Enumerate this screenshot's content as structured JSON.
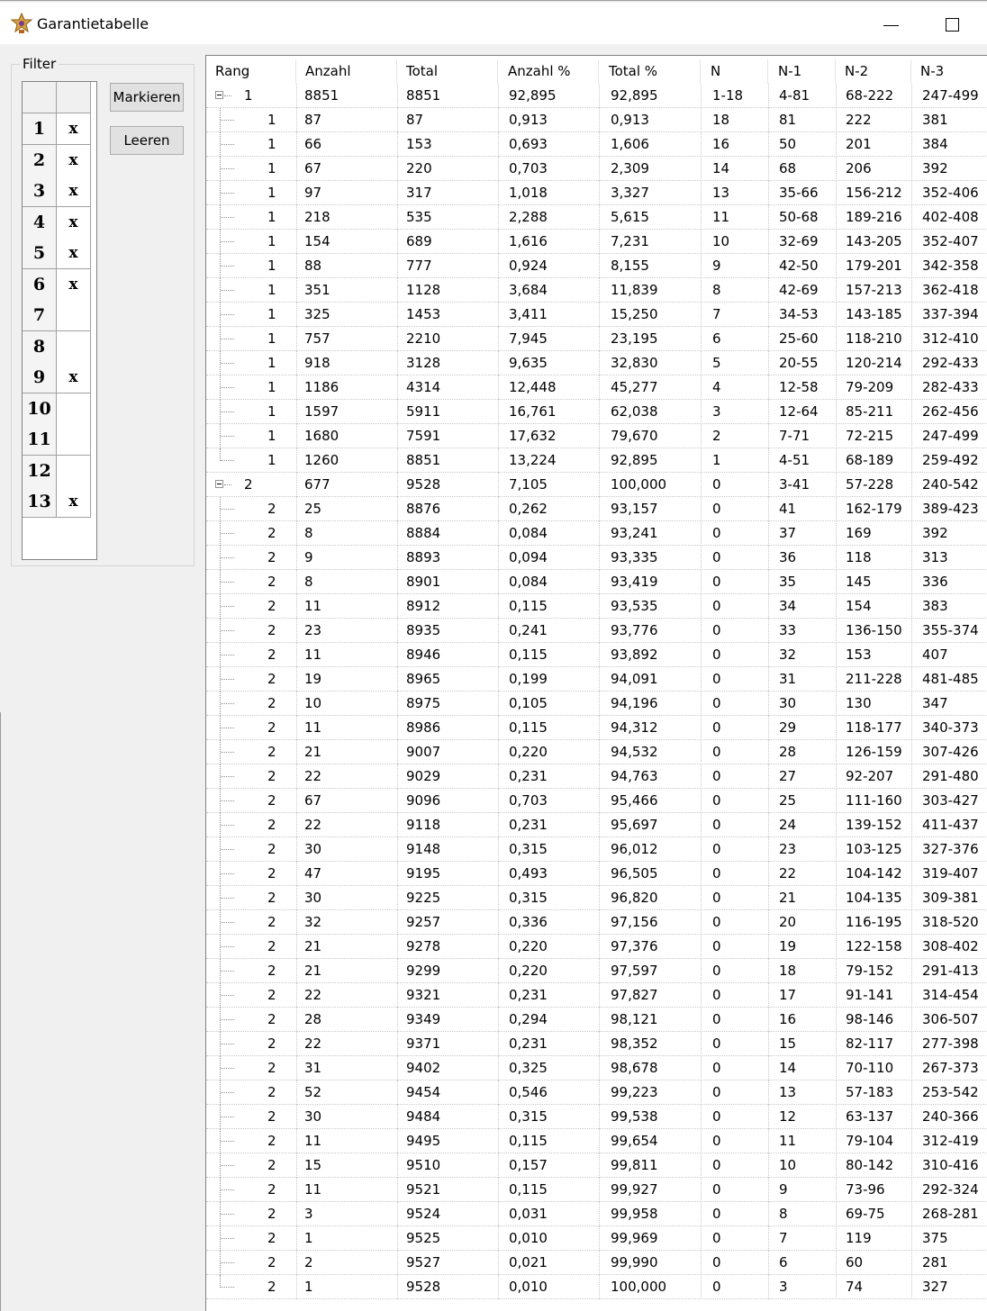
{
  "window": {
    "title": "Garantietabelle",
    "icon": "star-trophy-icon"
  },
  "filter": {
    "label": "Filter",
    "rows": [
      {
        "num": "1",
        "mark": "x"
      },
      {
        "num": "2",
        "mark": "x"
      },
      {
        "num": "3",
        "mark": "x"
      },
      {
        "num": "4",
        "mark": "x"
      },
      {
        "num": "5",
        "mark": "x"
      },
      {
        "num": "6",
        "mark": "x"
      },
      {
        "num": "7",
        "mark": ""
      },
      {
        "num": "8",
        "mark": ""
      },
      {
        "num": "9",
        "mark": "x"
      },
      {
        "num": "10",
        "mark": ""
      },
      {
        "num": "11",
        "mark": ""
      },
      {
        "num": "12",
        "mark": ""
      },
      {
        "num": "13",
        "mark": "x"
      }
    ],
    "buttons": {
      "mark": "Markieren",
      "clear": "Leeren"
    }
  },
  "table": {
    "columns": [
      "Rang",
      "Anzahl",
      "Total",
      "Anzahl %",
      "Total %",
      "N",
      "N-1",
      "N-2",
      "N-3"
    ],
    "rows": [
      {
        "level": 0,
        "rang": "1",
        "cells": [
          "8851",
          "8851",
          "92,895",
          "92,895",
          "1-18",
          "4-81",
          "68-222",
          "247-499"
        ]
      },
      {
        "level": 1,
        "rang": "1",
        "cells": [
          "87",
          "87",
          "0,913",
          "0,913",
          "18",
          "81",
          "222",
          "381"
        ]
      },
      {
        "level": 1,
        "rang": "1",
        "cells": [
          "66",
          "153",
          "0,693",
          "1,606",
          "16",
          "50",
          "201",
          "384"
        ]
      },
      {
        "level": 1,
        "rang": "1",
        "cells": [
          "67",
          "220",
          "0,703",
          "2,309",
          "14",
          "68",
          "206",
          "392"
        ]
      },
      {
        "level": 1,
        "rang": "1",
        "cells": [
          "97",
          "317",
          "1,018",
          "3,327",
          "13",
          "35-66",
          "156-212",
          "352-406"
        ]
      },
      {
        "level": 1,
        "rang": "1",
        "cells": [
          "218",
          "535",
          "2,288",
          "5,615",
          "11",
          "50-68",
          "189-216",
          "402-408"
        ]
      },
      {
        "level": 1,
        "rang": "1",
        "cells": [
          "154",
          "689",
          "1,616",
          "7,231",
          "10",
          "32-69",
          "143-205",
          "352-407"
        ]
      },
      {
        "level": 1,
        "rang": "1",
        "cells": [
          "88",
          "777",
          "0,924",
          "8,155",
          "9",
          "42-50",
          "179-201",
          "342-358"
        ]
      },
      {
        "level": 1,
        "rang": "1",
        "cells": [
          "351",
          "1128",
          "3,684",
          "11,839",
          "8",
          "42-69",
          "157-213",
          "362-418"
        ]
      },
      {
        "level": 1,
        "rang": "1",
        "cells": [
          "325",
          "1453",
          "3,411",
          "15,250",
          "7",
          "34-53",
          "143-185",
          "337-394"
        ]
      },
      {
        "level": 1,
        "rang": "1",
        "cells": [
          "757",
          "2210",
          "7,945",
          "23,195",
          "6",
          "25-60",
          "118-210",
          "312-410"
        ]
      },
      {
        "level": 1,
        "rang": "1",
        "cells": [
          "918",
          "3128",
          "9,635",
          "32,830",
          "5",
          "20-55",
          "120-214",
          "292-433"
        ]
      },
      {
        "level": 1,
        "rang": "1",
        "cells": [
          "1186",
          "4314",
          "12,448",
          "45,277",
          "4",
          "12-58",
          "79-209",
          "282-433"
        ]
      },
      {
        "level": 1,
        "rang": "1",
        "cells": [
          "1597",
          "5911",
          "16,761",
          "62,038",
          "3",
          "12-64",
          "85-211",
          "262-456"
        ]
      },
      {
        "level": 1,
        "rang": "1",
        "cells": [
          "1680",
          "7591",
          "17,632",
          "79,670",
          "2",
          "7-71",
          "72-215",
          "247-499"
        ]
      },
      {
        "level": 1,
        "rang": "1",
        "cells": [
          "1260",
          "8851",
          "13,224",
          "92,895",
          "1",
          "4-51",
          "68-189",
          "259-492"
        ]
      },
      {
        "level": 0,
        "rang": "2",
        "cells": [
          "677",
          "9528",
          "7,105",
          "100,000",
          "0",
          "3-41",
          "57-228",
          "240-542"
        ]
      },
      {
        "level": 1,
        "rang": "2",
        "cells": [
          "25",
          "8876",
          "0,262",
          "93,157",
          "0",
          "41",
          "162-179",
          "389-423"
        ]
      },
      {
        "level": 1,
        "rang": "2",
        "cells": [
          "8",
          "8884",
          "0,084",
          "93,241",
          "0",
          "37",
          "169",
          "392"
        ]
      },
      {
        "level": 1,
        "rang": "2",
        "cells": [
          "9",
          "8893",
          "0,094",
          "93,335",
          "0",
          "36",
          "118",
          "313"
        ]
      },
      {
        "level": 1,
        "rang": "2",
        "cells": [
          "8",
          "8901",
          "0,084",
          "93,419",
          "0",
          "35",
          "145",
          "336"
        ]
      },
      {
        "level": 1,
        "rang": "2",
        "cells": [
          "11",
          "8912",
          "0,115",
          "93,535",
          "0",
          "34",
          "154",
          "383"
        ]
      },
      {
        "level": 1,
        "rang": "2",
        "cells": [
          "23",
          "8935",
          "0,241",
          "93,776",
          "0",
          "33",
          "136-150",
          "355-374"
        ]
      },
      {
        "level": 1,
        "rang": "2",
        "cells": [
          "11",
          "8946",
          "0,115",
          "93,892",
          "0",
          "32",
          "153",
          "407"
        ]
      },
      {
        "level": 1,
        "rang": "2",
        "cells": [
          "19",
          "8965",
          "0,199",
          "94,091",
          "0",
          "31",
          "211-228",
          "481-485"
        ]
      },
      {
        "level": 1,
        "rang": "2",
        "cells": [
          "10",
          "8975",
          "0,105",
          "94,196",
          "0",
          "30",
          "130",
          "347"
        ]
      },
      {
        "level": 1,
        "rang": "2",
        "cells": [
          "11",
          "8986",
          "0,115",
          "94,312",
          "0",
          "29",
          "118-177",
          "340-373"
        ]
      },
      {
        "level": 1,
        "rang": "2",
        "cells": [
          "21",
          "9007",
          "0,220",
          "94,532",
          "0",
          "28",
          "126-159",
          "307-426"
        ]
      },
      {
        "level": 1,
        "rang": "2",
        "cells": [
          "22",
          "9029",
          "0,231",
          "94,763",
          "0",
          "27",
          "92-207",
          "291-480"
        ]
      },
      {
        "level": 1,
        "rang": "2",
        "cells": [
          "67",
          "9096",
          "0,703",
          "95,466",
          "0",
          "25",
          "111-160",
          "303-427"
        ]
      },
      {
        "level": 1,
        "rang": "2",
        "cells": [
          "22",
          "9118",
          "0,231",
          "95,697",
          "0",
          "24",
          "139-152",
          "411-437"
        ]
      },
      {
        "level": 1,
        "rang": "2",
        "cells": [
          "30",
          "9148",
          "0,315",
          "96,012",
          "0",
          "23",
          "103-125",
          "327-376"
        ]
      },
      {
        "level": 1,
        "rang": "2",
        "cells": [
          "47",
          "9195",
          "0,493",
          "96,505",
          "0",
          "22",
          "104-142",
          "319-407"
        ]
      },
      {
        "level": 1,
        "rang": "2",
        "cells": [
          "30",
          "9225",
          "0,315",
          "96,820",
          "0",
          "21",
          "104-135",
          "309-381"
        ]
      },
      {
        "level": 1,
        "rang": "2",
        "cells": [
          "32",
          "9257",
          "0,336",
          "97,156",
          "0",
          "20",
          "116-195",
          "318-520"
        ]
      },
      {
        "level": 1,
        "rang": "2",
        "cells": [
          "21",
          "9278",
          "0,220",
          "97,376",
          "0",
          "19",
          "122-158",
          "308-402"
        ]
      },
      {
        "level": 1,
        "rang": "2",
        "cells": [
          "21",
          "9299",
          "0,220",
          "97,597",
          "0",
          "18",
          "79-152",
          "291-413"
        ]
      },
      {
        "level": 1,
        "rang": "2",
        "cells": [
          "22",
          "9321",
          "0,231",
          "97,827",
          "0",
          "17",
          "91-141",
          "314-454"
        ]
      },
      {
        "level": 1,
        "rang": "2",
        "cells": [
          "28",
          "9349",
          "0,294",
          "98,121",
          "0",
          "16",
          "98-146",
          "306-507"
        ]
      },
      {
        "level": 1,
        "rang": "2",
        "cells": [
          "22",
          "9371",
          "0,231",
          "98,352",
          "0",
          "15",
          "82-117",
          "277-398"
        ]
      },
      {
        "level": 1,
        "rang": "2",
        "cells": [
          "31",
          "9402",
          "0,325",
          "98,678",
          "0",
          "14",
          "70-110",
          "267-373"
        ]
      },
      {
        "level": 1,
        "rang": "2",
        "cells": [
          "52",
          "9454",
          "0,546",
          "99,223",
          "0",
          "13",
          "57-183",
          "253-542"
        ]
      },
      {
        "level": 1,
        "rang": "2",
        "cells": [
          "30",
          "9484",
          "0,315",
          "99,538",
          "0",
          "12",
          "63-137",
          "240-366"
        ]
      },
      {
        "level": 1,
        "rang": "2",
        "cells": [
          "11",
          "9495",
          "0,115",
          "99,654",
          "0",
          "11",
          "79-104",
          "312-419"
        ]
      },
      {
        "level": 1,
        "rang": "2",
        "cells": [
          "15",
          "9510",
          "0,157",
          "99,811",
          "0",
          "10",
          "80-142",
          "310-416"
        ]
      },
      {
        "level": 1,
        "rang": "2",
        "cells": [
          "11",
          "9521",
          "0,115",
          "99,927",
          "0",
          "9",
          "73-96",
          "292-324"
        ]
      },
      {
        "level": 1,
        "rang": "2",
        "cells": [
          "3",
          "9524",
          "0,031",
          "99,958",
          "0",
          "8",
          "69-75",
          "268-281"
        ]
      },
      {
        "level": 1,
        "rang": "2",
        "cells": [
          "1",
          "9525",
          "0,010",
          "99,969",
          "0",
          "7",
          "119",
          "375"
        ]
      },
      {
        "level": 1,
        "rang": "2",
        "cells": [
          "2",
          "9527",
          "0,021",
          "99,990",
          "0",
          "6",
          "60",
          "281"
        ]
      },
      {
        "level": 1,
        "rang": "2",
        "cells": [
          "1",
          "9528",
          "0,010",
          "100,000",
          "0",
          "3",
          "74",
          "327"
        ]
      }
    ]
  }
}
